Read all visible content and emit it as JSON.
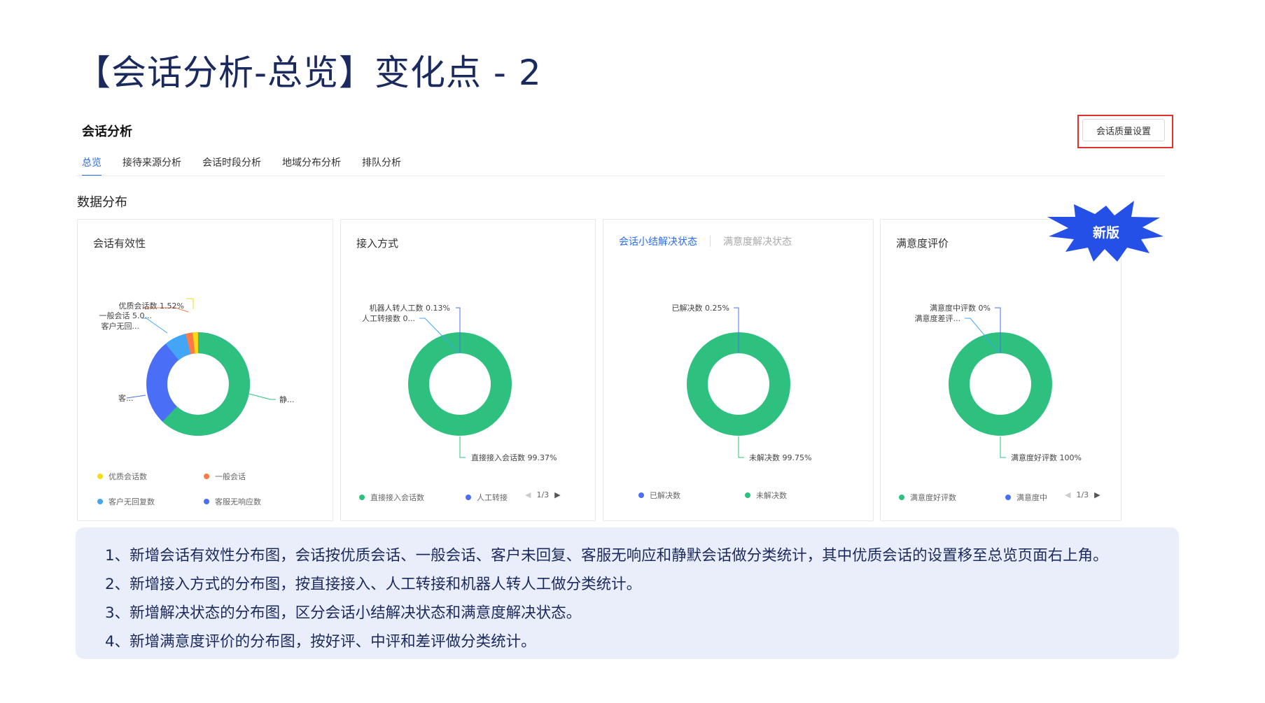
{
  "slide": {
    "title": "【会话分析-总览】变化点 - 2"
  },
  "header": {
    "title": "会话分析",
    "quality_button_label": "会话质量设置"
  },
  "tabs": [
    {
      "label": "总览",
      "active": true
    },
    {
      "label": "接待来源分析",
      "active": false
    },
    {
      "label": "会话时段分析",
      "active": false
    },
    {
      "label": "地域分布分析",
      "active": false
    },
    {
      "label": "排队分析",
      "active": false
    }
  ],
  "section": {
    "title": "数据分布"
  },
  "badge": {
    "label": "新版",
    "color": "#2450e8"
  },
  "colors": {
    "green": "#2ec07e",
    "blue": "#4a6ef5",
    "lightblue": "#42a5f5",
    "orange": "#ff7a45",
    "yellow": "#fadb14",
    "accent": "#2b6de8"
  },
  "cards": [
    {
      "title": "会话有效性",
      "chart_data": {
        "type": "pie",
        "labels": [
          "优质会话数 1.52%",
          "一般会话 5.0...",
          "客户无回...",
          "客...",
          "静..."
        ],
        "legend": [
          "优质会话数",
          "一般会话",
          "客户无回复数",
          "客服无响应数"
        ]
      },
      "pager": ""
    },
    {
      "title": "接入方式",
      "chart_data": {
        "type": "pie",
        "labels": [
          "机器人转人工数 0.13%",
          "人工转接数 0...",
          "直接接入会话数 99.37%"
        ],
        "legend": [
          "直接接入会话数",
          "人工转接"
        ]
      },
      "pager": "1/3"
    },
    {
      "sub_tabs": [
        "会话小结解决状态",
        "满意度解决状态"
      ],
      "chart_data": {
        "type": "pie",
        "labels": [
          "已解决数 0.25%",
          "未解决数 99.75%"
        ],
        "legend": [
          "已解决数",
          "未解决数"
        ]
      },
      "pager": ""
    },
    {
      "title": "满意度评价",
      "chart_data": {
        "type": "pie",
        "labels": [
          "满意度中评数 0%",
          "满意度差评...",
          "满意度好评数 100%"
        ],
        "legend": [
          "满意度好评数",
          "满意度中"
        ]
      },
      "pager": "1/3"
    }
  ],
  "notes": [
    "1、新增会话有效性分布图，会话按优质会话、一般会话、客户未回复、客服无响应和静默会话做分类统计，其中优质会话的设置移至总览页面右上角。",
    "2、新增接入方式的分布图，按直接接入、人工转接和机器人转人工做分类统计。",
    "3、新增解决状态的分布图，区分会话小结解决状态和满意度解决状态。",
    "4、新增满意度评价的分布图，按好评、中评和差评做分类统计。"
  ]
}
